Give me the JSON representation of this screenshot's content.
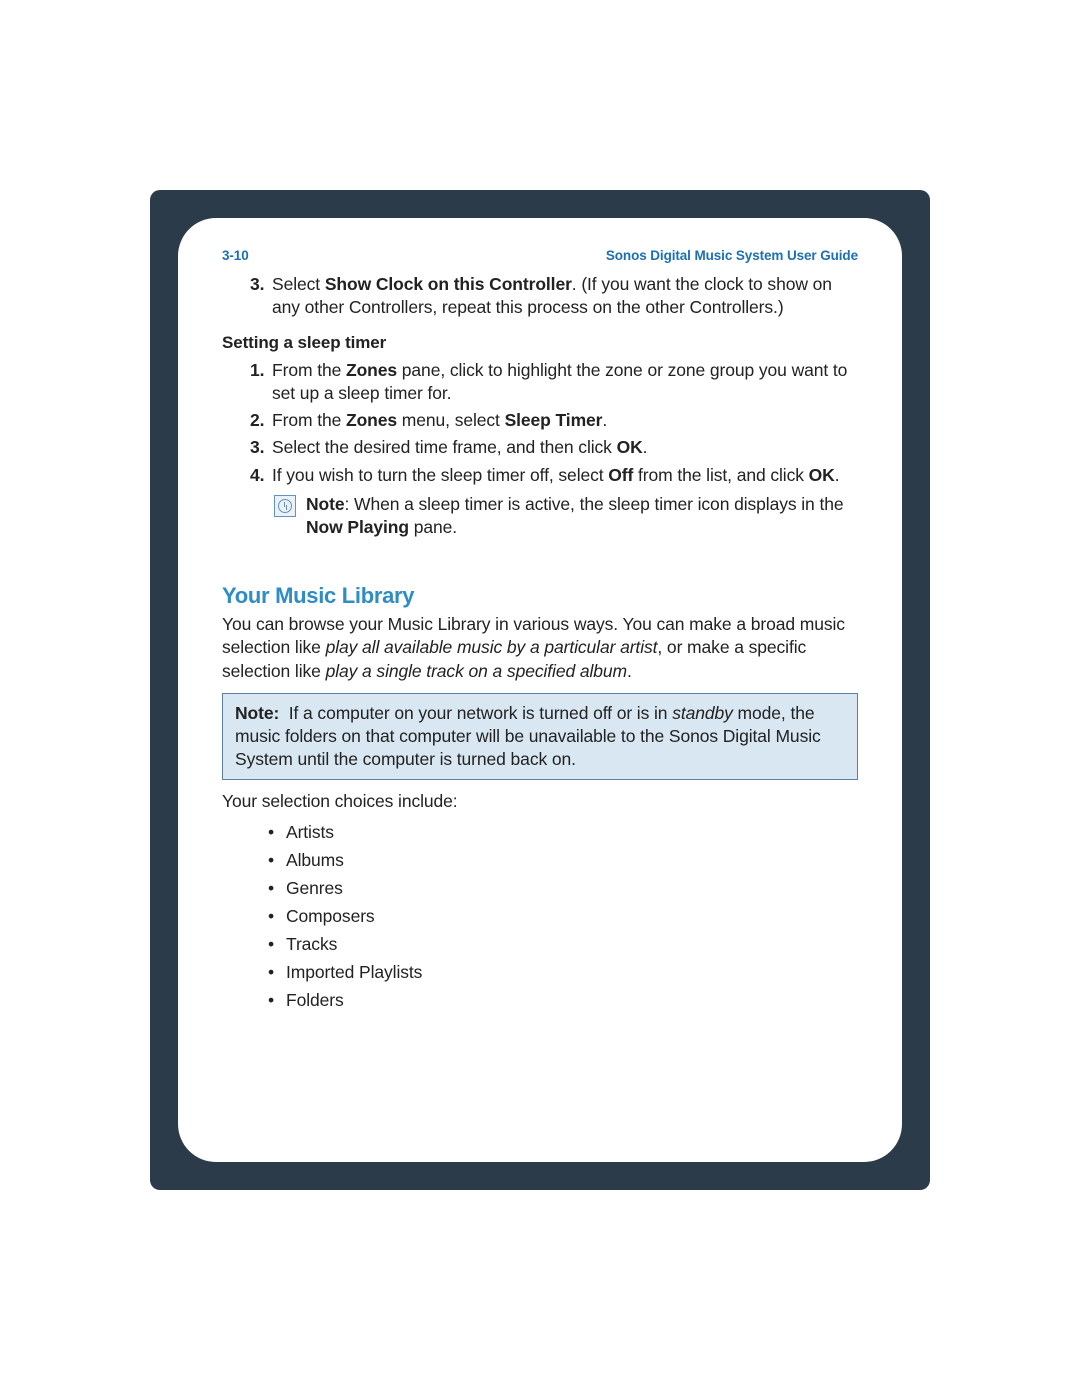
{
  "header": {
    "page_num": "3-10",
    "guide_title": "Sonos Digital Music System User Guide"
  },
  "clock_step": {
    "num": "3.",
    "pre": "Select ",
    "bold": "Show Clock on this Controller",
    "post": ". (If you want the clock to show on any other Controllers, repeat this process on the other Controllers.)"
  },
  "sleep": {
    "heading": "Setting a sleep timer",
    "steps": [
      {
        "num": "1.",
        "html": "From the <b>Zones</b> pane, click to highlight the zone or zone group you want to set up a sleep timer for."
      },
      {
        "num": "2.",
        "html": "From the <b>Zones</b> menu, select <b>Sleep Timer</b>."
      },
      {
        "num": "3.",
        "html": "Select the desired time frame, and then click <b>OK</b>."
      },
      {
        "num": "4.",
        "html": "If you wish to turn the sleep timer off, select <b>Off</b> from the list, and click <b>OK</b>."
      }
    ],
    "note_html": "<b>Note</b>: When a sleep timer is active, the sleep timer icon displays in the <b>Now Playing</b> pane."
  },
  "library": {
    "heading": "Your Music Library",
    "intro_html": "You can browse your Music Library in various ways. You can make a broad music selection like <i class='eg'>play all available music by a particular artist</i>, or make a specific selection like <i class='eg'>play a single track on a specified album</i>.",
    "note_html": "<b>Note:</b>&nbsp;&nbsp;If a computer on your network is turned off or is in <i class='eg'>standby</i> mode, the music folders on that computer will be unavailable to the Sonos Digital Music System until the computer is turned back on.",
    "choices_intro": "Your selection choices include:",
    "choices": [
      "Artists",
      "Albums",
      "Genres",
      "Composers",
      "Tracks",
      "Imported Playlists",
      "Folders"
    ]
  }
}
